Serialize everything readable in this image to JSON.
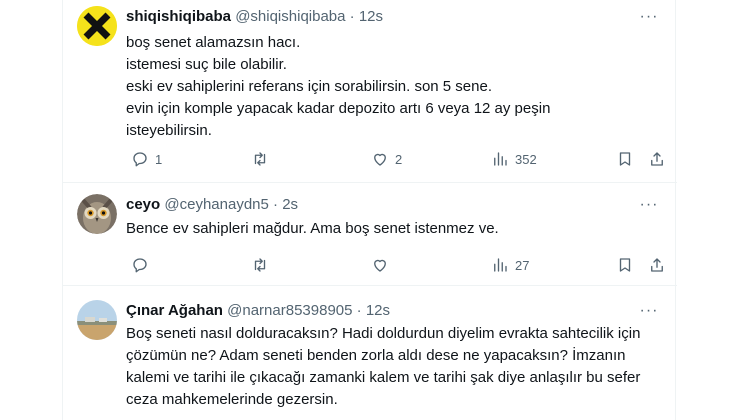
{
  "tweets": [
    {
      "name": "shiqishiqibaba",
      "handle": "@shiqishiqibaba",
      "dot": "·",
      "time": "12s",
      "lines": [
        "boş senet alamazsın hacı.",
        "istemesi suç bile olabilir.",
        "eski ev sahiplerini referans için sorabilirsin. son 5 sene.",
        "evin için komple yapacak kadar depozito artı 6 veya 12 ay peşin isteyebilirsin."
      ],
      "replies": "1",
      "retweets": "",
      "likes": "2",
      "views": "352"
    },
    {
      "name": "ceyo",
      "handle": "@ceyhanaydn5",
      "dot": "·",
      "time": "2s",
      "lines": [
        "Bence ev sahipleri mağdur. Ama boş senet istenmez ve."
      ],
      "replies": "",
      "retweets": "",
      "likes": "",
      "views": "27"
    },
    {
      "name": "Çınar Ağahan",
      "handle": "@narnar85398905",
      "dot": "·",
      "time": "12s",
      "lines": [
        "Boş seneti nasıl dolduracaksın? Hadi doldurdun diyelim evrakta sahtecilik için çözümün ne? Adam seneti benden zorla aldı dese ne yapacaksın? İmzanın kalemi ve tarihi ile çıkacağı zamanki kalem ve tarihi şak diye anlaşılır bu sefer ceza mahkemelerinde gezersin."
      ]
    }
  ],
  "colors": {
    "text": "#0f1419",
    "muted": "#536471",
    "divider": "#eff3f4",
    "avatar1_bg": "#f5e21b"
  },
  "icons": [
    "reply-icon",
    "retweet-icon",
    "like-icon",
    "views-icon",
    "bookmark-icon",
    "share-icon",
    "more-icon"
  ]
}
